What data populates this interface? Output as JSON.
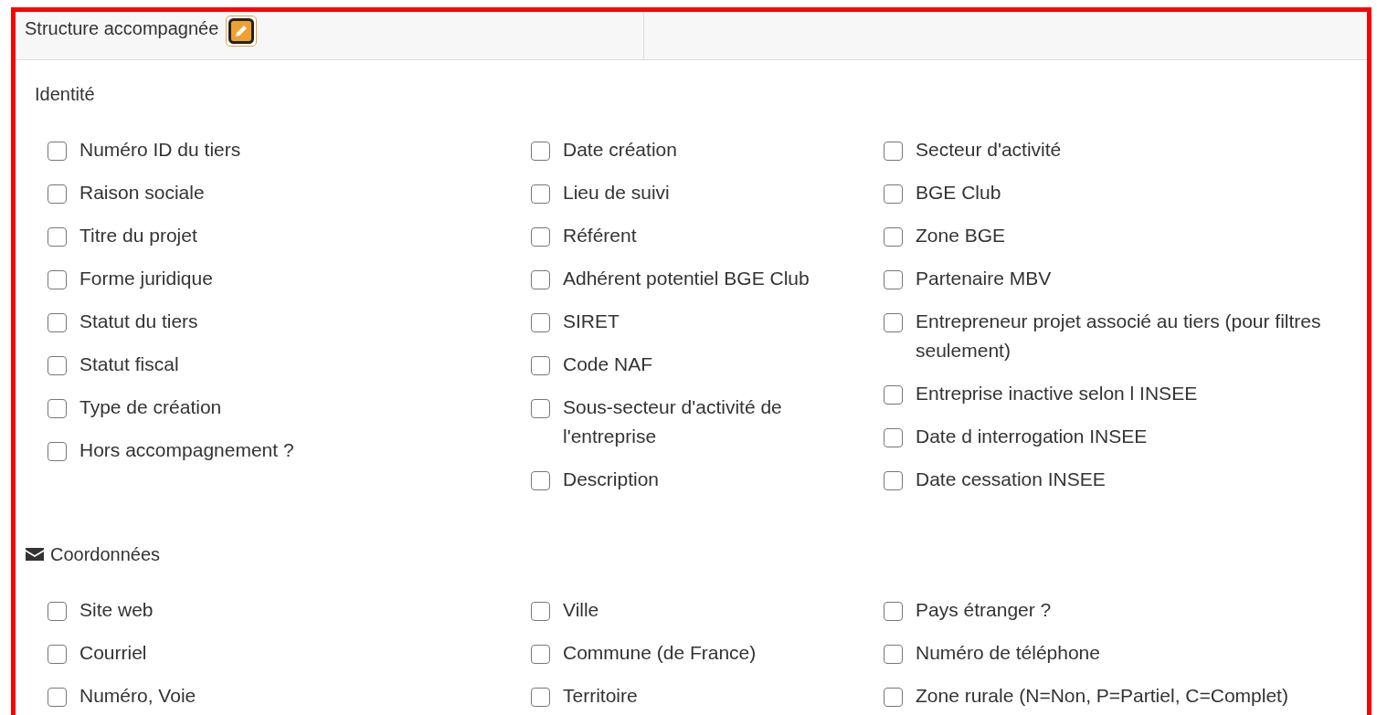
{
  "header": {
    "title": "Structure accompagnée"
  },
  "sections": [
    {
      "title": "Identité",
      "kind": "plain",
      "columns": [
        [
          {
            "label": "Numéro ID du tiers",
            "checked": false
          },
          {
            "label": "Raison sociale",
            "checked": false
          },
          {
            "label": "Titre du projet",
            "checked": false
          },
          {
            "label": "Forme juridique",
            "checked": false
          },
          {
            "label": "Statut du tiers",
            "checked": false
          },
          {
            "label": "Statut fiscal",
            "checked": false
          },
          {
            "label": "Type de création",
            "checked": false
          },
          {
            "label": "Hors accompagnement ?",
            "checked": false
          }
        ],
        [
          {
            "label": "Date création",
            "checked": false
          },
          {
            "label": "Lieu de suivi",
            "checked": false
          },
          {
            "label": "Référent",
            "checked": false
          },
          {
            "label": "Adhérent potentiel BGE Club",
            "checked": false
          },
          {
            "label": "SIRET",
            "checked": false
          },
          {
            "label": "Code NAF",
            "checked": false
          },
          {
            "label": "Sous-secteur d'activité de l'entreprise",
            "checked": false
          },
          {
            "label": "Description",
            "checked": false
          }
        ],
        [
          {
            "label": "Secteur d'activité",
            "checked": false
          },
          {
            "label": "BGE Club",
            "checked": false
          },
          {
            "label": "Zone BGE",
            "checked": false
          },
          {
            "label": "Partenaire MBV",
            "checked": false
          },
          {
            "label": "Entrepreneur projet associé au tiers (pour filtres seulement)",
            "checked": false
          },
          {
            "label": "Entreprise inactive selon l INSEE",
            "checked": false
          },
          {
            "label": "Date d interrogation INSEE",
            "checked": false
          },
          {
            "label": "Date cessation INSEE",
            "checked": false
          }
        ]
      ]
    },
    {
      "title": "Coordonnées",
      "kind": "contact",
      "columns": [
        [
          {
            "label": "Site web",
            "checked": false
          },
          {
            "label": "Courriel",
            "checked": false
          },
          {
            "label": "Numéro, Voie",
            "checked": false
          }
        ],
        [
          {
            "label": "Ville",
            "checked": false
          },
          {
            "label": "Commune (de France)",
            "checked": false
          },
          {
            "label": "Territoire",
            "checked": false
          }
        ],
        [
          {
            "label": "Pays étranger ?",
            "checked": false
          },
          {
            "label": "Numéro de téléphone",
            "checked": false
          },
          {
            "label": "Zone rurale (N=Non, P=Partiel, C=Complet)",
            "checked": false
          }
        ]
      ]
    }
  ]
}
